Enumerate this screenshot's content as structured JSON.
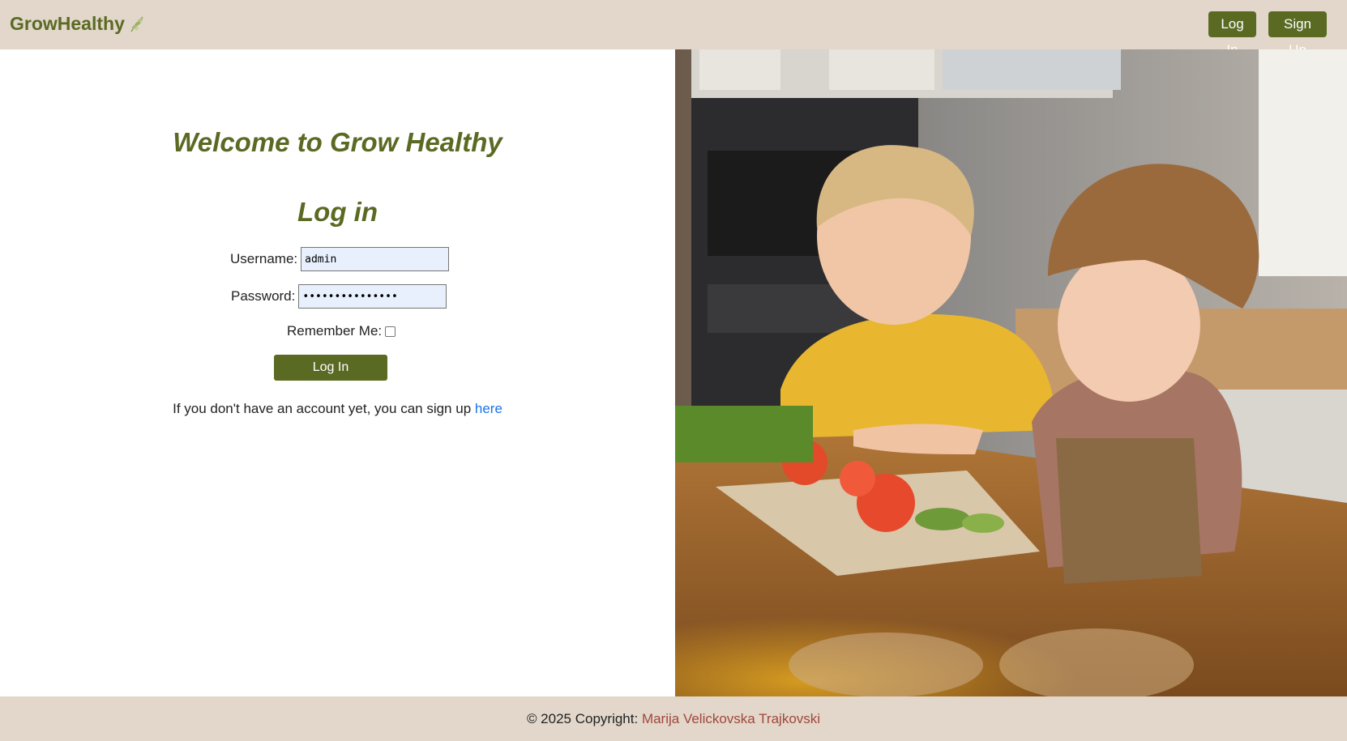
{
  "header": {
    "brand": "GrowHealthy",
    "brand_icon": "leaf-icon",
    "login_label": "Log In",
    "signup_label": "Sign Up"
  },
  "login_form": {
    "welcome": "Welcome to Grow Healthy",
    "title": "Log in",
    "username_label": "Username:",
    "username_value": "admin",
    "password_label": "Password:",
    "password_value": "•••••••••••••••",
    "remember_label": "Remember Me:",
    "remember_checked": false,
    "submit_label": "Log In",
    "signup_prompt": "If you don't have an account yet, you can sign up ",
    "signup_link": "here"
  },
  "hero_image": {
    "description_icon": "kids-cooking-photo"
  },
  "footer": {
    "copyright": "© 2025 Copyright: ",
    "author": "Marija Velickovska Trajkovski"
  },
  "colors": {
    "brand_green": "#5a6a23",
    "header_bg": "#e2d7ca",
    "link_blue": "#1a73e8",
    "footer_author": "#a0473a"
  }
}
